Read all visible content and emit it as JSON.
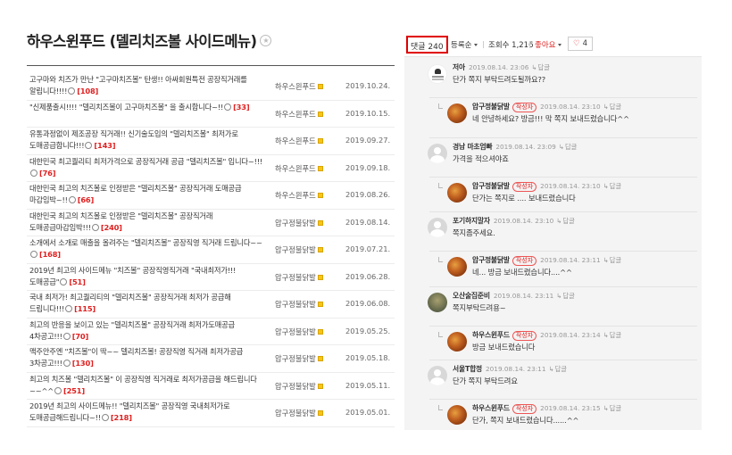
{
  "board_title": "하우스윈푸드 (델리치즈볼 사이드메뉴)",
  "posts": [
    {
      "title": "고구마와 치즈가 만난 \"고구마치즈볼\" 탄생!! 아싸회원특전 공장직거래를 알립니다!!!!",
      "count": "[108]",
      "author": "하우스윈푸드",
      "date": "2019.10.24."
    },
    {
      "title": "\"신제품출시!!!! \"델리치즈볼이 고구마치즈볼\" 을 출시합니다~!!",
      "count": "[33]",
      "author": "하우스윈푸드",
      "date": "2019.10.15."
    },
    {
      "title": "유통과정없이 제조공장 직거래!! 신기술도입의 \"델리치즈볼\" 최저가로 도매공급합니다!!!",
      "count": "[143]",
      "author": "하우스윈푸드",
      "date": "2019.09.27."
    },
    {
      "title": "대한민국 최고퀄리티 최저가격으로 공장직거래 공급 \"델리치즈볼\" 입니다~!!!",
      "count": "[76]",
      "author": "하우스윈푸드",
      "date": "2019.09.18."
    },
    {
      "title": "대한민국 최고의 치즈볼로 인정받은 \"델리치즈볼\" 공장직거래 도매공급 마감임박~!!",
      "count": "[66]",
      "author": "하우스윈푸드",
      "date": "2019.08.26."
    },
    {
      "title": "대한민국 최고의 치즈볼로 인정받은 \"델리치즈볼\" 공장직거래 도매공급마감임박!!!",
      "count": "[240]",
      "author": "압구정불닭발",
      "date": "2019.08.14."
    },
    {
      "title": "소개에서 소개로 매출을 올려주는 \"델리치즈볼\" 공장직영 직거래 드립니다~~",
      "count": "[168]",
      "author": "압구정불닭발",
      "date": "2019.07.21."
    },
    {
      "title": "2019년 최고의 사이드메뉴 \"치즈볼\" 공장직영직거래 \"국내최저가!!! 도매공급\"",
      "count": "[51]",
      "author": "압구정불닭발",
      "date": "2019.06.28."
    },
    {
      "title": "국내 최저가! 최고퀄리티의 \"델리치즈볼\" 공장직거래 최저가 공급해 드립니다!!!",
      "count": "[115]",
      "author": "압구정불닭발",
      "date": "2019.06.08."
    },
    {
      "title": "최고의 반응을 보이고 있는 \"델리치즈볼\" 공장직거래 최저가도매공급 4차공고!!!",
      "count": "[70]",
      "author": "압구정불닭발",
      "date": "2019.05.25."
    },
    {
      "title": "맥주안주엔 \"치즈볼\"이 딱~~ 델리치즈볼! 공장직영 직거래 최저가공급 3차공고!!!",
      "count": "[130]",
      "author": "압구정불닭발",
      "date": "2019.05.18."
    },
    {
      "title": "최고의 치즈볼 \"델리치즈볼\" 이 공장직영 직거래로 최저가공급을 해드립니다~~^^",
      "count": "[251]",
      "author": "압구정불닭발",
      "date": "2019.05.11."
    },
    {
      "title": "2019년 최고의 사이드메뉴!! \"델리치즈볼\" 공장직영 국내최저가로 도매공급해드립니다~!!",
      "count": "[218]",
      "author": "압구정불닭발",
      "date": "2019.05.01."
    }
  ],
  "toolbar": {
    "comment_count": "댓글 240",
    "sort": "등록순",
    "views": "조회수 1,216",
    "like": "좋아요",
    "heart_icon": "heart-icon",
    "heart_count": "4"
  },
  "writer_badge": "작성자",
  "reply_label": "답글",
  "comments": [
    {
      "avatar": "logo",
      "is_reply": false,
      "name": "저아",
      "date": "2019.08.14. 23:06",
      "text": "단가 쪽지 부탁드려도될까요??"
    },
    {
      "avatar": "food",
      "is_reply": true,
      "name": "압구정불닭발",
      "writer": true,
      "date": "2019.08.14. 23:10",
      "text": "네 안녕하세요? 방금!!! 막 쪽지 보내드렸습니다^^"
    },
    {
      "avatar": "person",
      "is_reply": false,
      "name": "경남 마초엄빠",
      "date": "2019.08.14. 23:09",
      "text": "가격을 적으셔야죠"
    },
    {
      "avatar": "food",
      "is_reply": true,
      "name": "압구정불닭발",
      "writer": true,
      "date": "2019.08.14. 23:10",
      "text": "단가는 쪽지로 .... 보내드렸습니다"
    },
    {
      "avatar": "person",
      "is_reply": false,
      "name": "포기하지말자",
      "date": "2019.08.14. 23:10",
      "text": "쪽지좀주세요."
    },
    {
      "avatar": "food",
      "is_reply": true,
      "name": "압구정불닭발",
      "writer": true,
      "date": "2019.08.14. 23:11",
      "text": "네... 방금 보내드렸습니다....^^"
    },
    {
      "avatar": "photo",
      "is_reply": false,
      "name": "오산술집준비",
      "date": "2019.08.14. 23:11",
      "text": "쪽지부탁드려용~"
    },
    {
      "avatar": "food",
      "is_reply": true,
      "name": "하우스윈푸드",
      "writer": true,
      "date": "2019.08.14. 23:14",
      "text": "방금 보내드렸습니다"
    },
    {
      "avatar": "person",
      "is_reply": false,
      "name": "서울T합정",
      "date": "2019.08.14. 23:11",
      "text": "단가 쪽지 부탁드려요"
    },
    {
      "avatar": "food",
      "is_reply": true,
      "name": "하우스윈푸드",
      "writer": true,
      "date": "2019.08.14. 23:15",
      "text": "단가, 쪽지 보내드렸습니다......^^"
    }
  ]
}
